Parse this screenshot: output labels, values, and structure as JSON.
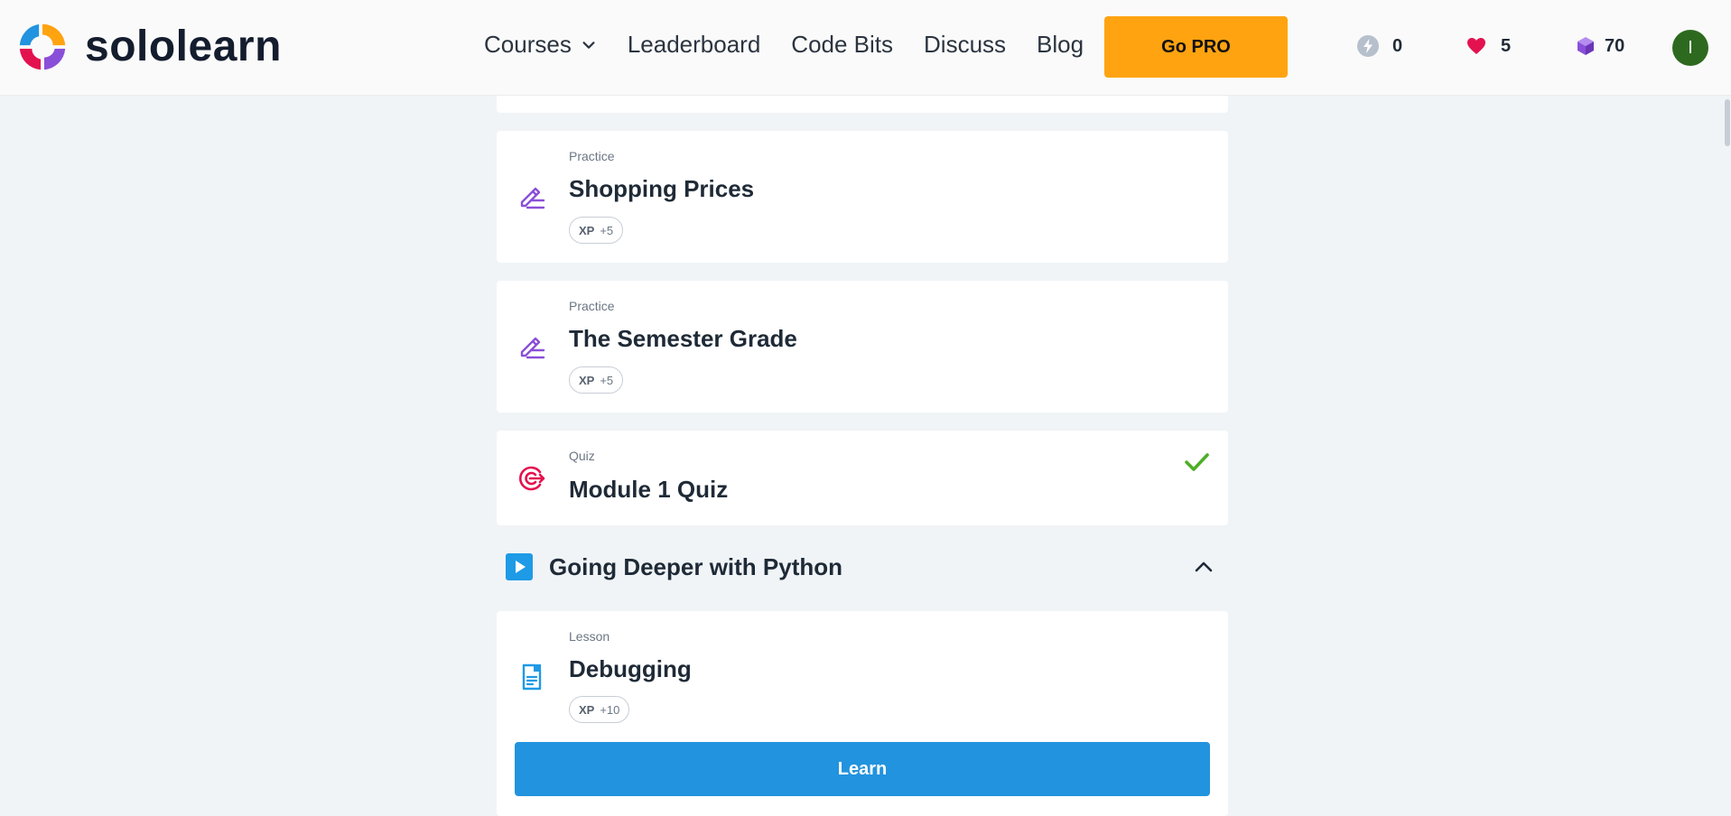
{
  "header": {
    "logo_text": "sololearn",
    "nav": [
      {
        "label": "Courses",
        "has_dropdown": true
      },
      {
        "label": "Leaderboard"
      },
      {
        "label": "Code Bits"
      },
      {
        "label": "Discuss"
      },
      {
        "label": "Blog"
      }
    ],
    "go_pro_label": "Go PRO",
    "stats": {
      "streak": "0",
      "hearts": "5",
      "bits": "70"
    },
    "avatar_initial": "I"
  },
  "items": [
    {
      "type": "Practice",
      "title": "Shopping Prices",
      "xp_label": "XP",
      "xp_value": "+5",
      "icon": "pencil-icon"
    },
    {
      "type": "Practice",
      "title": "The Semester Grade",
      "xp_label": "XP",
      "xp_value": "+5",
      "icon": "pencil-icon"
    },
    {
      "type": "Quiz",
      "title": "Module 1 Quiz",
      "icon": "target-icon",
      "completed": true
    }
  ],
  "module": {
    "title": "Going Deeper with Python",
    "expanded": true
  },
  "lesson": {
    "type": "Lesson",
    "title": "Debugging",
    "xp_label": "XP",
    "xp_value": "+10",
    "icon": "lesson-icon",
    "button_label": "Learn"
  },
  "colors": {
    "accent_blue": "#2293de",
    "pro_orange": "#ffa310",
    "practice_purple": "#8a4fd8",
    "quiz_red": "#e3124f",
    "check_green": "#4caf26"
  }
}
